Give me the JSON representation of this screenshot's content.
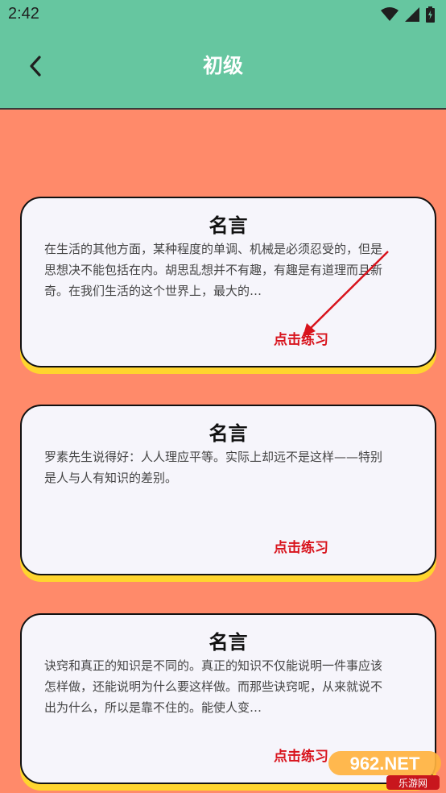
{
  "status": {
    "time": "2:42"
  },
  "header": {
    "title": "初级",
    "back_icon": "chevron-left-icon"
  },
  "cards": [
    {
      "title": "名言",
      "text": "在生活的其他方面，某种程度的单调、机械是必须忍受的，但是思想决不能包括在内。胡思乱想并不有趣，有趣是有道理而且新奇。在我们生活的这个世界上，最大的…",
      "action": "点击练习"
    },
    {
      "title": "名言",
      "text": "罗素先生说得好：人人理应平等。实际上却远不是这样——特别是人与人有知识的差别。",
      "action": "点击练习"
    },
    {
      "title": "名言",
      "text": "诀窍和真正的知识是不同的。真正的知识不仅能说明一件事应该怎样做，还能说明为什么要这样做。而那些诀窍呢，从来就说不出为什么，所以是靠不住的。能使人变…",
      "action": "点击练习"
    }
  ],
  "watermark": {
    "brand": "962.NET",
    "sub": "乐游网"
  },
  "colors": {
    "header": "#66C6A0",
    "background": "#FF8A6A",
    "card_shadow": "#FFD52E",
    "action": "#D8131C"
  }
}
